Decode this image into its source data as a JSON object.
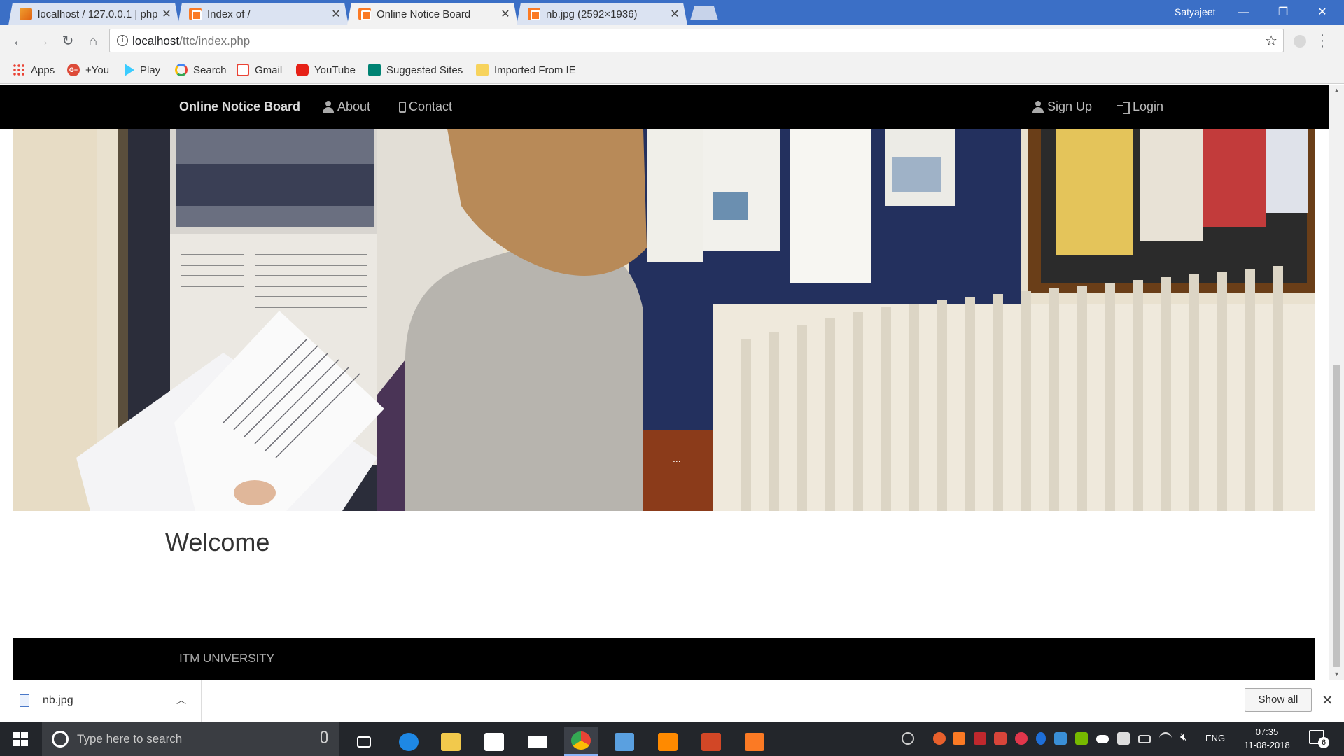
{
  "browser": {
    "tabs": [
      {
        "label": "localhost / 127.0.0.1 | php",
        "icon": "phpmyadmin-icon"
      },
      {
        "label": "Index of /",
        "icon": "xampp-icon"
      },
      {
        "label": "Online Notice Board",
        "icon": "xampp-icon",
        "active": true
      },
      {
        "label": "nb.jpg (2592×1936)",
        "icon": "xampp-icon"
      }
    ],
    "profile": "Satyajeet",
    "url_host": "localhost",
    "url_path": "/ttc/index.php",
    "bookmarks": [
      "Apps",
      "+You",
      "Play",
      "Search",
      "Gmail",
      "YouTube",
      "Suggested Sites",
      "Imported From IE"
    ]
  },
  "page": {
    "navbar": {
      "brand": "Online Notice Board",
      "about": "About",
      "contact": "Contact",
      "signup": "Sign Up",
      "login": "Login"
    },
    "hero_indicator": "...",
    "welcome": "Welcome",
    "footer": "ITM UNIVERSITY"
  },
  "download_shelf": {
    "file": "nb.jpg",
    "show_all": "Show all"
  },
  "taskbar": {
    "search_placeholder": "Type here to search",
    "language": "ENG",
    "time": "07:35",
    "date": "11-08-2018",
    "notifications": "6"
  },
  "colors": {
    "titlebar": "#3b6fc6",
    "navbar": "#000000",
    "footer": "#000000",
    "taskbar": "#23262b"
  }
}
